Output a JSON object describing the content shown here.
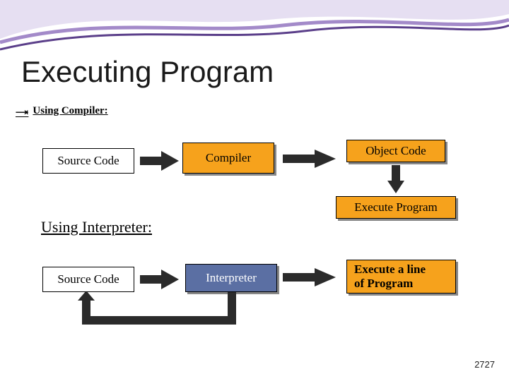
{
  "title": "Executing Program",
  "section1": "Using Compiler:",
  "section2": "Using Interpreter:",
  "boxes": {
    "srcA": "Source Code",
    "compiler": "Compiler",
    "objcode": "Object Code",
    "execprog": "Execute Program",
    "srcB": "Source Code",
    "interp": "Interpreter",
    "execline": "Execute a line\nof Program"
  },
  "footer": "2727"
}
